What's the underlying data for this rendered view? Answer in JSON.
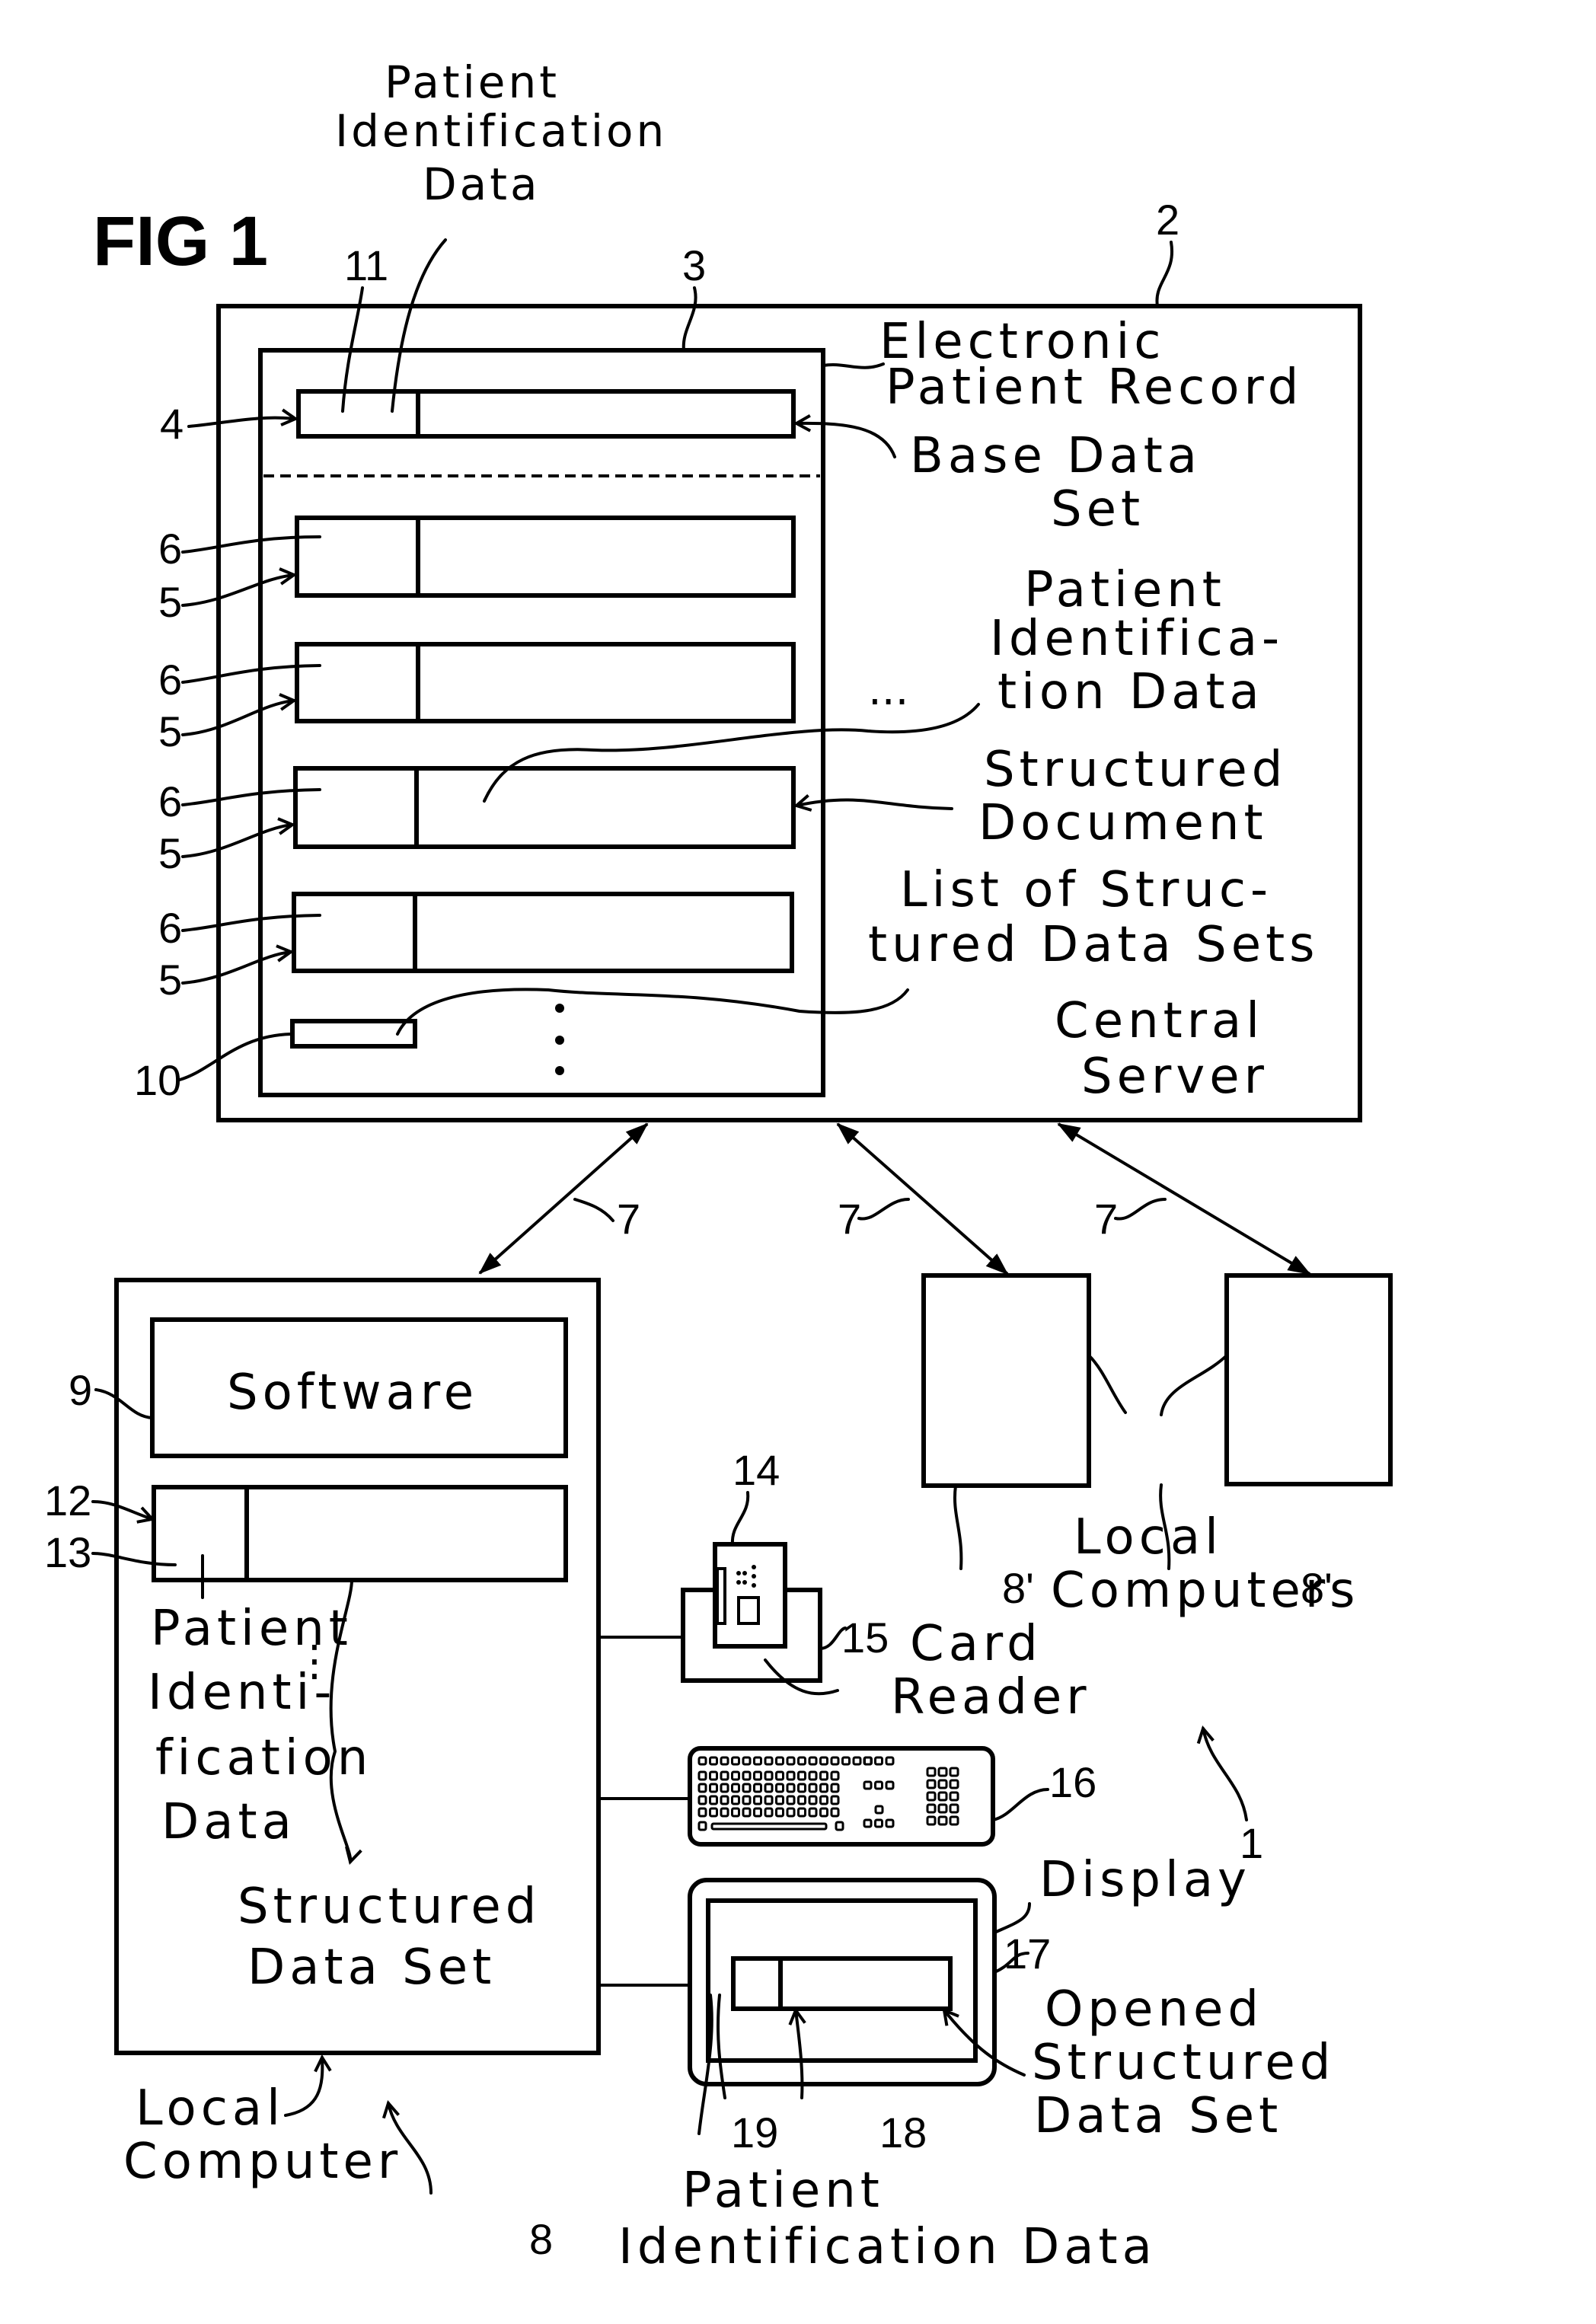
{
  "figure": {
    "title": "FIG 1",
    "reference_numerals": {
      "system": "1",
      "central_server": "2",
      "electronic_patient_record": "3",
      "base_data_set": "4",
      "structured_document": "5",
      "patient_identification_data_field": "6",
      "network_link": "7",
      "local_computer": "8",
      "other_local_computer": "8'",
      "software": "9",
      "list_of_structured_data_sets": "10",
      "base_patient_identification_data": "11",
      "structured_data_set": "12",
      "structured_data_set_patient_identification": "13",
      "patient_card": "14",
      "card_reader": "15",
      "keyboard": "16",
      "display": "17",
      "opened_structured_data_set": "18",
      "opened_patient_identification": "19"
    },
    "labels": {
      "top_patient_identification_data": [
        "Patient",
        "Identification",
        "Data"
      ],
      "electronic_patient_record": [
        "Electronic",
        "Patient Record"
      ],
      "base_data_set": [
        "Base Data",
        "Set"
      ],
      "patient_identification_data_right": [
        "Patient",
        "Identifica-",
        "tion Data"
      ],
      "structured_document": [
        "Structured",
        "Document"
      ],
      "list_of_structured_data_sets": [
        "List of Struc-",
        "tured Data Sets"
      ],
      "central_server": [
        "Central",
        "Server"
      ],
      "software": "Software",
      "patient_identification_data_left": [
        "Patient",
        "Identi-",
        "fication",
        "Data"
      ],
      "structured_data_set": [
        "Structured",
        "Data Set"
      ],
      "local_computer": [
        "Local",
        "Computer"
      ],
      "local_computers": [
        "Local",
        "Computers"
      ],
      "card_reader": [
        "Card",
        "Reader"
      ],
      "display": "Display",
      "opened_structured_data_set": [
        "Opened",
        "Structured",
        "Data Set"
      ],
      "patient_identification_data_bottom": [
        "Patient",
        "Identification Data"
      ]
    },
    "ellipsis_horizontal": "...",
    "ellipsis_vertical": "⋮"
  }
}
